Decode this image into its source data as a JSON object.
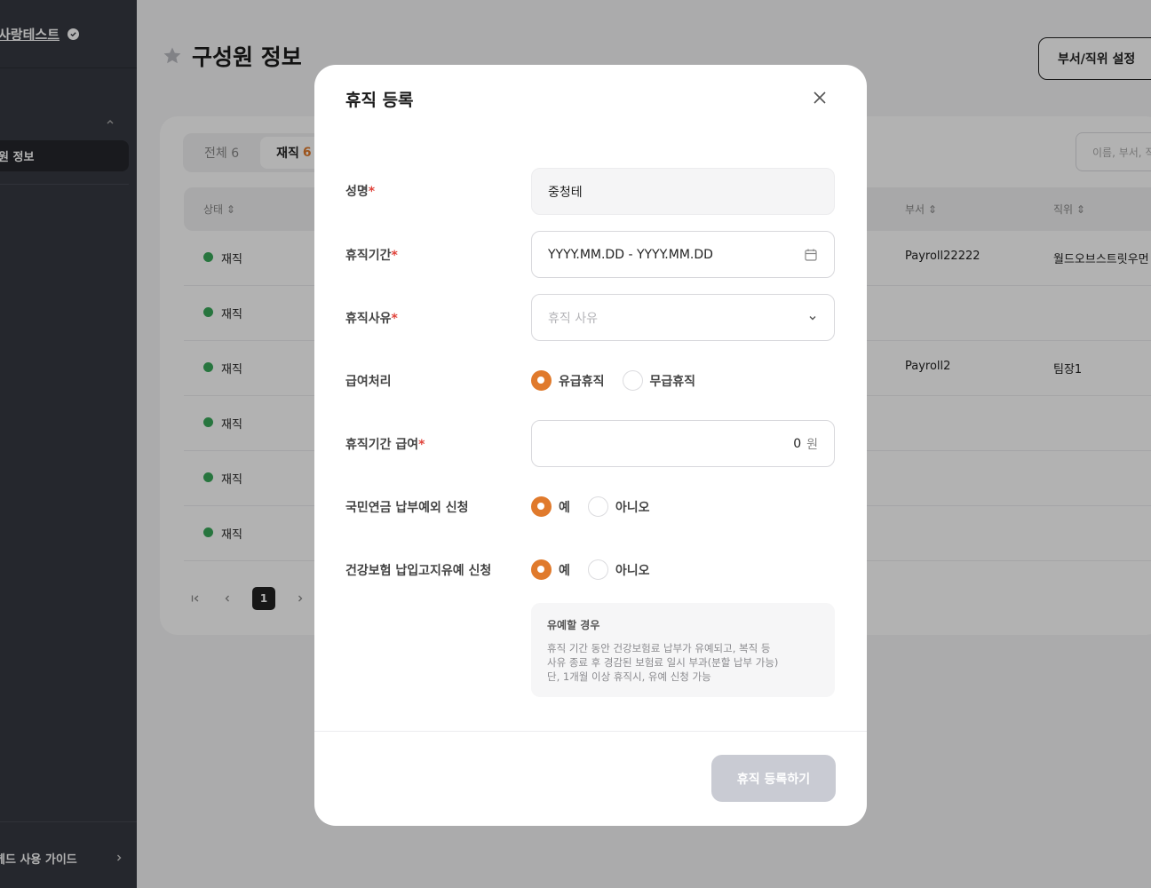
{
  "sidebar": {
    "company": "사랑테스트",
    "active_item": "원 정보",
    "guide": "헤드 사용 가이드"
  },
  "page": {
    "title": "구성원 정보",
    "dept_button": "부서/직위 설정",
    "tabs": [
      {
        "label": "전체 6"
      },
      {
        "label": "재직",
        "count": "6"
      }
    ],
    "search_placeholder": "이름, 부서, 직",
    "columns": {
      "status": "상태 ⇕",
      "dept": "부서 ⇕",
      "position": "직위 ⇕"
    },
    "rows": [
      {
        "status": "재직",
        "dept": "Payroll22222",
        "position": "월드오브스트릿우먼"
      },
      {
        "status": "재직",
        "dept": "",
        "position": ""
      },
      {
        "status": "재직",
        "dept": "Payroll2",
        "position": "팀장1"
      },
      {
        "status": "재직",
        "dept": "",
        "position": ""
      },
      {
        "status": "재직",
        "dept": "",
        "position": ""
      },
      {
        "status": "재직",
        "dept": "",
        "position": ""
      }
    ],
    "current_page": "1"
  },
  "modal": {
    "title": "휴직 등록",
    "name_label": "성명",
    "name_value": "중청테",
    "period_label": "휴직기간",
    "period_placeholder": "YYYY.MM.DD - YYYY.MM.DD",
    "reason_label": "휴직사유",
    "reason_placeholder": "휴직 사유",
    "pay_label": "급여처리",
    "pay_options": [
      "유급휴직",
      "무급휴직"
    ],
    "pay_selected": "유급휴직",
    "salary_label": "휴직기간 급여",
    "salary_value": "0",
    "salary_unit": "원",
    "pension_label": "국민연금 납부예외 신청",
    "pension_options": [
      "예",
      "아니오"
    ],
    "health_label": "건강보험 납입고지유예 신청",
    "health_options": [
      "예",
      "아니오"
    ],
    "required_mark": "*",
    "notice_title": "유예할 경우",
    "notice_lines": [
      "휴직 기간 동안 건강보험료 납부가 유예되고, 복직 등",
      "사유 종료 후 경감된 보험료 일시 부과(분할 납부 가능)",
      "단, 1개월 이상 휴직시, 유예 신청 가능"
    ],
    "submit": "휴직 등록하기"
  },
  "colors": {
    "accent": "#e07a2c",
    "status_active": "#38a85a",
    "required": "#e0433b"
  }
}
